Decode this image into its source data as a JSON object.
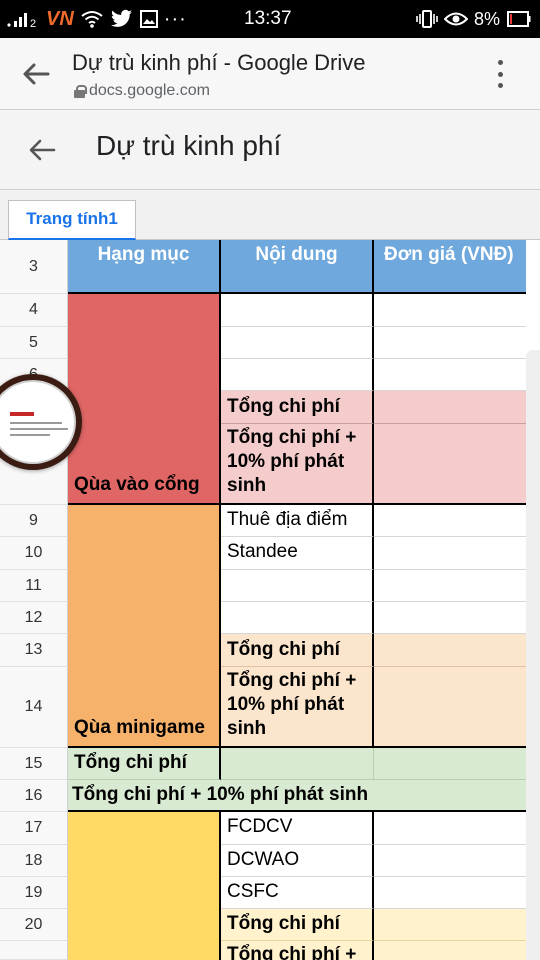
{
  "status_bar": {
    "carrier_brand": "VN",
    "network_type": "2",
    "clock": "13:37",
    "battery_percent": "8%",
    "icons": [
      "signal-icon",
      "wifi-icon",
      "twitter-icon",
      "gallery-icon",
      "more-dots-icon",
      "vibrate-icon",
      "eye-icon",
      "battery-icon"
    ]
  },
  "browser": {
    "title": "Dự trù kinh phí - Google Drive",
    "url": "docs.google.com"
  },
  "doc": {
    "title": "Dự trù kinh phí"
  },
  "sheet_tab": "Trang tính1",
  "colors": {
    "header_blue": "#6fa8dc",
    "red_category": "#e06666",
    "red_light": "#f4cccc",
    "orange_category": "#f6b26b",
    "orange_light": "#fce5cd",
    "green_light": "#d9ead3",
    "yellow_category": "#ffd966",
    "yellow_light": "#fff2cc",
    "tab_blue": "#1a73e8"
  },
  "table": {
    "headers": [
      "Hạng mục",
      "Nội dung",
      "Đơn giá (VNĐ)"
    ],
    "row_numbers": [
      "3",
      "4",
      "5",
      "6",
      "",
      "",
      "9",
      "10",
      "11",
      "12",
      "13",
      "14",
      "15",
      "16",
      "17",
      "18",
      "19",
      "20",
      ""
    ],
    "groups": {
      "gate_gift": "Qùa vào cổng",
      "minigame_gift": "Qùa minigame"
    },
    "content": {
      "r7": "Tổng chi phí",
      "r8": "Tổng chi phí + 10% phí phát sinh",
      "r9": "Thuê địa điểm",
      "r10": "Standee",
      "r13": "Tổng chi phí",
      "r14": "Tổng chi phí + 10% phí phát sinh",
      "r17": "FCDCV",
      "r18": "DCWAO",
      "r19": "CSFC",
      "r20": "Tổng chi phí",
      "r21": "Tổng chi phí +"
    },
    "summary": {
      "r15": "Tổng chi phí",
      "r16": "Tổng chi phí + 10% phí phát sinh"
    }
  }
}
